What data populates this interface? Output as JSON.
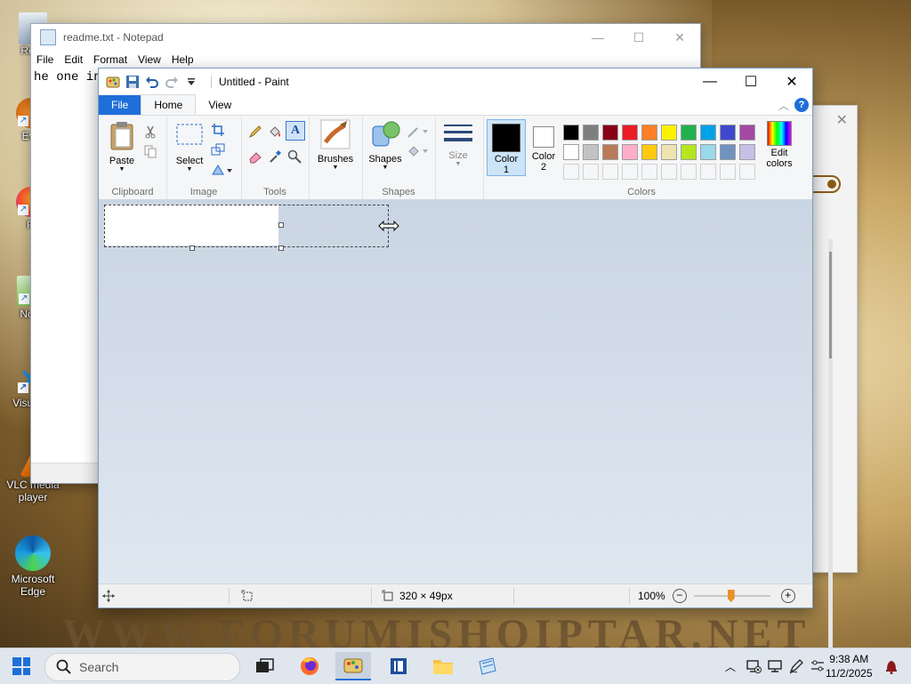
{
  "desktop": {
    "icons": [
      {
        "label": "Recy",
        "name": "recycle-bin"
      },
      {
        "label": "Eve",
        "name": "everything"
      },
      {
        "label": "Fi",
        "name": "firefox"
      },
      {
        "label": "Note",
        "name": "notepad-plus"
      },
      {
        "label": "Visua C",
        "name": "visual-studio-code"
      },
      {
        "label": "VLC media player",
        "name": "vlc-media-player"
      },
      {
        "label": "Microsoft Edge",
        "name": "microsoft-edge"
      }
    ],
    "watermark": "WWW.FORUMISHQIPTAR.NET"
  },
  "notepad": {
    "title": "readme.txt - Notepad",
    "menu": [
      "File",
      "Edit",
      "Format",
      "View",
      "Help"
    ],
    "text": "he one in"
  },
  "paint": {
    "title": "Untitled - Paint",
    "tabs": {
      "file": "File",
      "home": "Home",
      "view": "View"
    },
    "help_icon": "?",
    "groups": {
      "clipboard": {
        "label": "Clipboard",
        "paste": "Paste"
      },
      "image": {
        "label": "Image",
        "select": "Select"
      },
      "tools": {
        "label": "Tools",
        "brushes": "Brushes"
      },
      "shapes": {
        "label": "Shapes",
        "shapes": "Shapes"
      },
      "size": {
        "label": "Size"
      },
      "colors": {
        "label": "Colors",
        "color1": "Color\n1",
        "color2": "Color\n2",
        "edit_colors": "Edit\ncolors"
      }
    },
    "palette_row1": [
      "#000000",
      "#7f7f7f",
      "#880015",
      "#ed1c24",
      "#ff7f27",
      "#fff200",
      "#22b14c",
      "#00a2e8",
      "#3f48cc",
      "#a349a4"
    ],
    "palette_row2": [
      "#ffffff",
      "#c3c3c3",
      "#b97a57",
      "#ffaec9",
      "#ffc90e",
      "#efe4b0",
      "#b5e61d",
      "#99d9ea",
      "#7092be",
      "#c8bfe7"
    ],
    "color1": "#000000",
    "color2": "#ffffff",
    "status": {
      "selection_size": "320 × 49px",
      "zoom": "100%"
    }
  },
  "taskbar": {
    "search_placeholder": "Search",
    "time": "9:38 AM",
    "date": "11/2/2025"
  }
}
